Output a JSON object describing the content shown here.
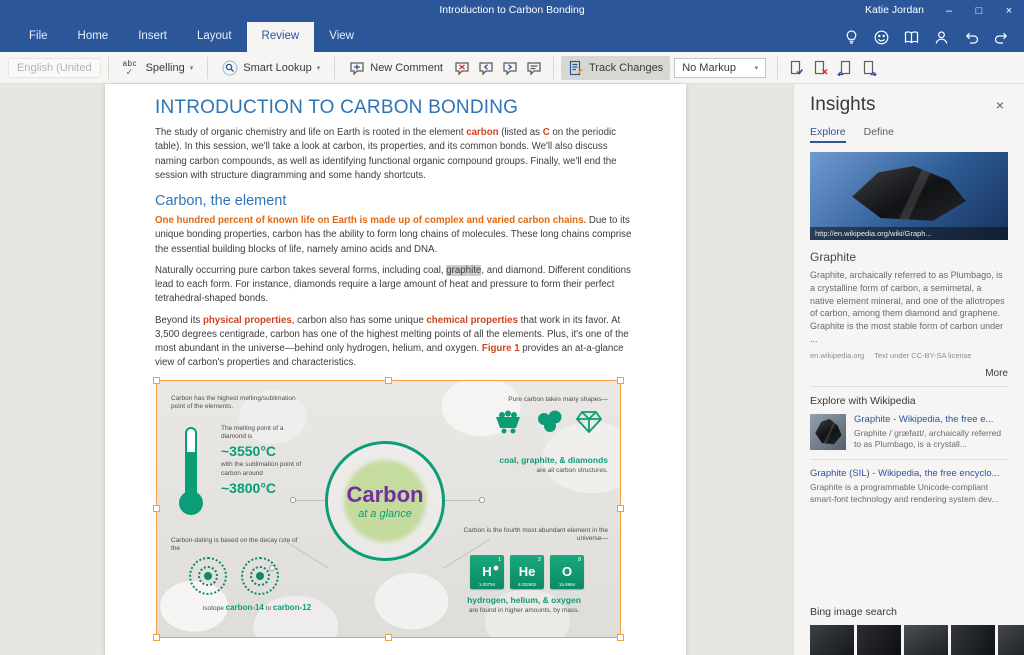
{
  "colors": {
    "accent": "#2b579a",
    "selection": "#f0a13c",
    "teal": "#0b9d77",
    "purple": "#7030a0",
    "heading_blue": "#2e74b5"
  },
  "titlebar": {
    "title": "Introduction to Carbon Bonding",
    "user": "Katie Jordan",
    "minimize": "–",
    "maximize": "□",
    "close": "×"
  },
  "tabs": [
    {
      "label": "File"
    },
    {
      "label": "Home"
    },
    {
      "label": "Insert"
    },
    {
      "label": "Layout"
    },
    {
      "label": "Review"
    },
    {
      "label": "View"
    }
  ],
  "ribbon": {
    "language": "English (United",
    "spelling_abc": "abc",
    "spelling": "Spelling",
    "smart_lookup": "Smart Lookup",
    "new_comment": "New Comment",
    "track_changes": "Track Changes",
    "no_markup": "No Markup",
    "chevron": "▾"
  },
  "document": {
    "heading1": "INTRODUCTION TO CARBON BONDING",
    "heading2": "Carbon, the element",
    "para1": [
      "The study of organic chemistry and life on Earth is rooted in the element ",
      "carbon",
      " (listed as ",
      "C",
      " on the periodic table). In this session, we'll take a look at carbon, its properties, and its common bonds. We'll also discuss naming carbon compounds, as well as identifying functional organic compound groups. Finally, we'll end the session with structure diagramming and some handy shortcuts."
    ],
    "para2": [
      "One hundred percent of known life on Earth is made up of complex and varied carbon chains.",
      " Due to its unique bonding properties, carbon has the ability to form long chains of molecules. These long chains comprise the essential building blocks of life, namely amino acids and DNA."
    ],
    "para3": [
      "Naturally occurring pure carbon takes several forms, including coal, ",
      "graphite",
      ", and diamond. Different conditions lead to each form. For instance, diamonds require a large amount of heat and pressure to form their perfect tetrahedral-shaped bonds."
    ],
    "para4": [
      "Beyond its ",
      "physical properties",
      ", carbon also has some unique ",
      "chemical properties",
      " that work in its favor. At 3,500 degrees centigrade, carbon has one of the highest melting points of all the elements. Plus, it's one of the most abundant in the universe—behind only hydrogen, helium, and oxygen. ",
      "Figure 1",
      " provides an at-a-glance view of carbon's properties and characteristics."
    ]
  },
  "figure": {
    "melt_note": "Carbon has the highest melting/sublimation point of the elements.",
    "melt_line1": "The melting point of a diamond is",
    "temp1": "~3550°C",
    "melt_line2": "with the sublimation point of carbon around",
    "temp2": "~3800°C",
    "shapes_note": "Pure carbon takes many shapes—",
    "shapes_label": "coal, graphite, & diamonds",
    "shapes_sub": "are all carbon structures.",
    "center_title": "Carbon",
    "center_sub": "at a glance",
    "dating_note": "Carbon-dating is based on the decay rate of the",
    "isotope_prefix": "isotope",
    "isotope1": "carbon-14",
    "isotope_to": "to",
    "isotope2": "carbon-12",
    "abundance_note": "Carbon is the fourth most abundant element in the universe—",
    "elements": [
      {
        "symbol": "H",
        "number": "1",
        "mass": "1.00794"
      },
      {
        "symbol": "He",
        "number": "2",
        "mass": "4.002602"
      },
      {
        "symbol": "O",
        "number": "8",
        "mass": "15.9994"
      }
    ],
    "elements_label": "hydrogen, helium, & oxygen",
    "elements_sub": "are found in higher amounts, by mass."
  },
  "insights": {
    "title": "Insights",
    "close": "×",
    "tab_explore": "Explore",
    "tab_define": "Define",
    "hero_url": "http://en.wikipedia.org/wiki/Graph...",
    "card_title": "Graphite",
    "card_text": "Graphite, archaically referred to as Plumbago, is a crystalline form of carbon, a semimetal, a native element mineral, and one of the allotropes of carbon, among them diamond and graphene. Graphite is the most stable form of carbon under ...",
    "card_source": "en.wikipedia.org",
    "card_license": "Text under CC-BY-SA license",
    "more": "More",
    "wiki_header": "Explore with Wikipedia",
    "results": [
      {
        "title": "Graphite - Wikipedia, the free e...",
        "text": "Graphite /ˈɡræfaɪt/, archaically referred to as Plumbago, is a crystall..."
      },
      {
        "title": "Graphite (SIL) - Wikipedia, the free encyclo...",
        "text": "Graphite is a programmable Unicode-compliant smart-font technology and rendering system dev..."
      }
    ],
    "bing_header": "Bing image search"
  }
}
